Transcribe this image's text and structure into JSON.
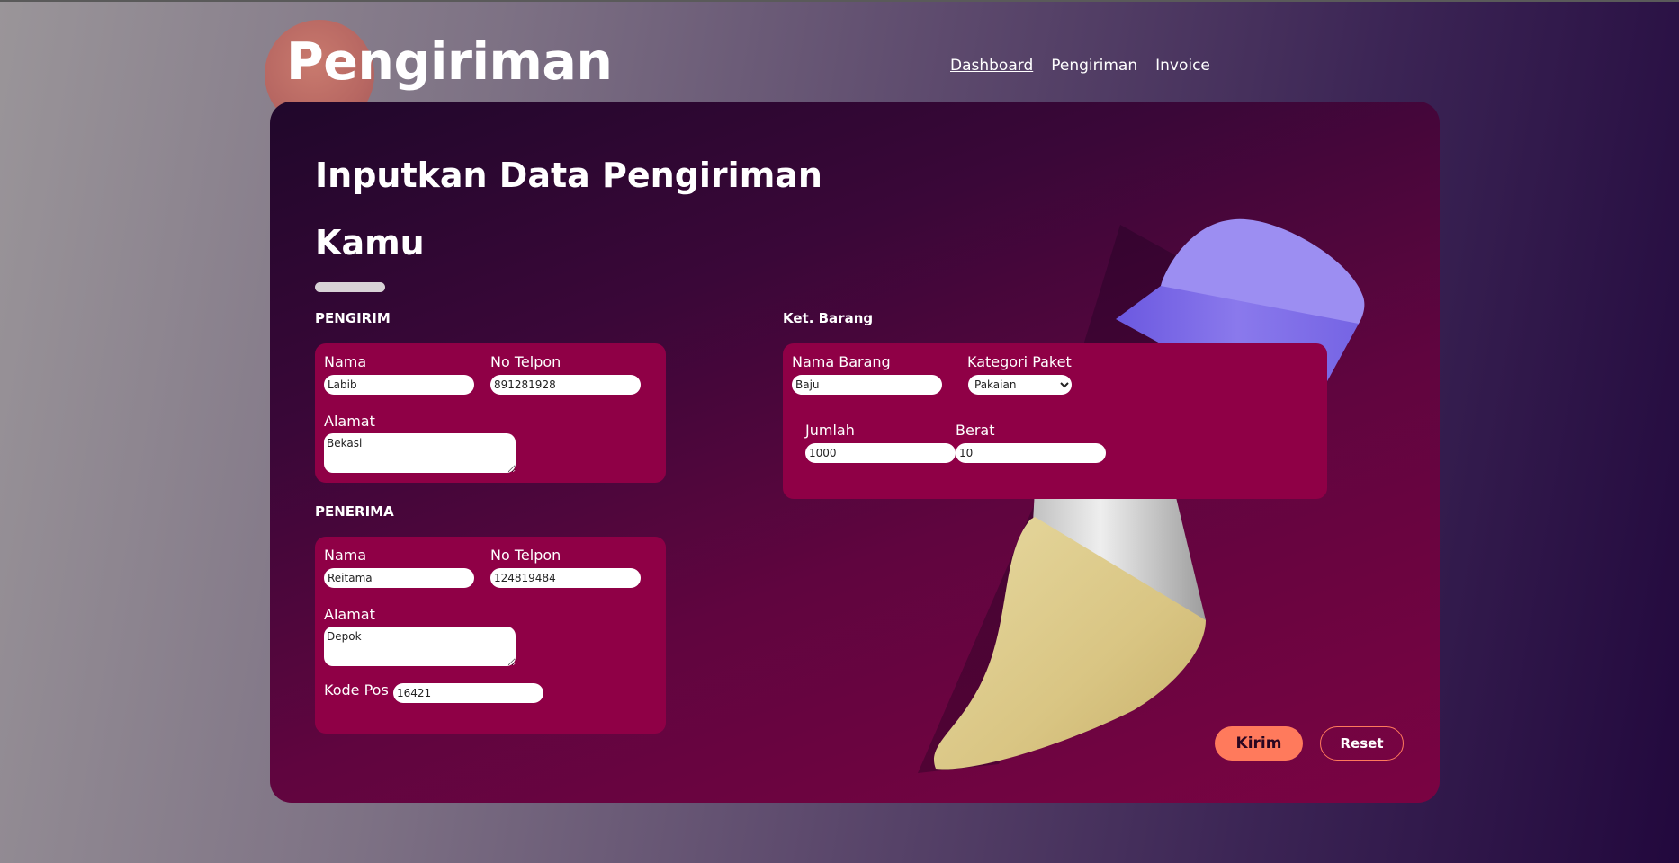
{
  "brand": "Pengiriman",
  "nav": [
    {
      "label": "Dashboard",
      "active": true
    },
    {
      "label": "Pengiriman",
      "active": false
    },
    {
      "label": "Invoice",
      "active": false
    }
  ],
  "form": {
    "title_line1": "Inputkan Data Pengiriman",
    "title_line2": "Kamu",
    "pengirim": {
      "section": "PENGIRIM",
      "nama_label": "Nama",
      "nama_value": "Labib",
      "telp_label": "No Telpon",
      "telp_value": "891281928",
      "alamat_label": "Alamat",
      "alamat_value": "Bekasi"
    },
    "penerima": {
      "section": "PENERIMA",
      "nama_label": "Nama",
      "nama_value": "Reitama",
      "telp_label": "No Telpon",
      "telp_value": "124819484",
      "alamat_label": "Alamat",
      "alamat_value": "Depok",
      "kodepos_label": "Kode Pos",
      "kodepos_value": "16421"
    },
    "barang": {
      "section": "Ket. Barang",
      "nama_label": "Nama Barang",
      "nama_value": "Baju",
      "kategori_label": "Kategori Paket",
      "kategori_value": "Pakaian",
      "jumlah_label": "Jumlah",
      "jumlah_value": "1000",
      "berat_label": "Berat",
      "berat_value": "10"
    },
    "submit_label": "Kirim",
    "reset_label": "Reset"
  },
  "colors": {
    "panel": "#8f0046",
    "accent": "#ff7a5c",
    "brand_circle": "#b76762"
  },
  "icons": [
    "brush-illustration"
  ]
}
